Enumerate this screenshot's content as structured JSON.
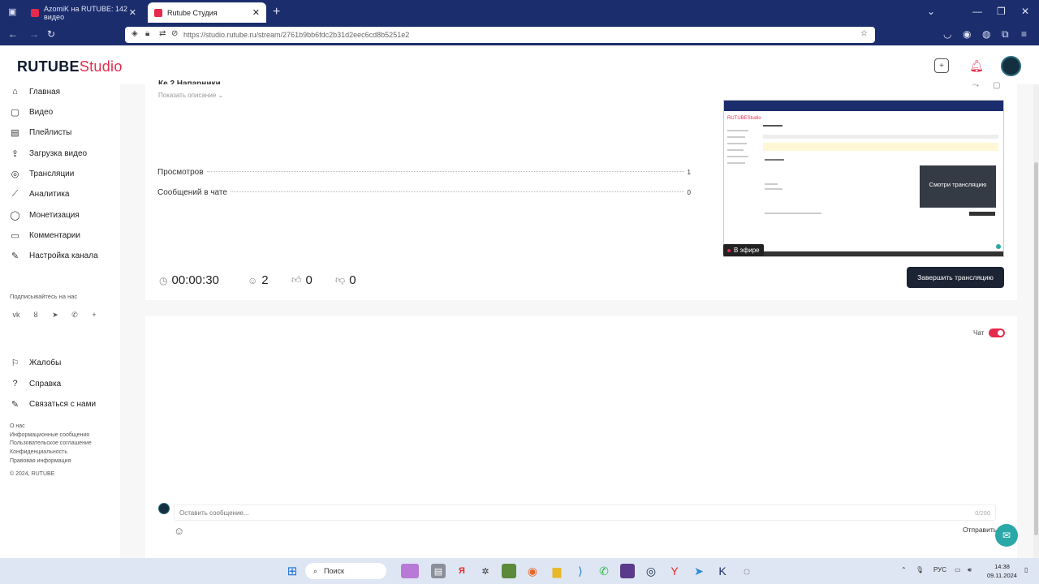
{
  "browser": {
    "tabs": [
      {
        "label": "AzomiK на RUTUBE: 142 видео"
      },
      {
        "label": "Rutube Студия"
      }
    ],
    "url": "https://studio.rutube.ru/stream/2761b9bb6fdc2b31d2eec6cd8b5251e2"
  },
  "app": {
    "logo_main": "RUTUBE",
    "logo_studio": "Studio"
  },
  "sidebar": {
    "items": [
      {
        "label": "Главная",
        "icon": "home-icon"
      },
      {
        "label": "Видео",
        "icon": "video-icon"
      },
      {
        "label": "Плейлисты",
        "icon": "playlist-icon"
      },
      {
        "label": "Загрузка видео",
        "icon": "upload-icon"
      },
      {
        "label": "Трансляции",
        "icon": "broadcast-icon"
      },
      {
        "label": "Аналитика",
        "icon": "analytics-icon"
      },
      {
        "label": "Монетизация",
        "icon": "monetization-icon"
      },
      {
        "label": "Комментарии",
        "icon": "comments-icon"
      },
      {
        "label": "Настройка канала",
        "icon": "settings-icon"
      }
    ],
    "subscribe_label": "Подписывайтесь на нас",
    "social": [
      "vk-icon",
      "ok-icon",
      "telegram-icon",
      "viber-icon",
      "plus-icon"
    ],
    "support_items": [
      {
        "label": "Жалобы",
        "icon": "complaint-icon"
      },
      {
        "label": "Справка",
        "icon": "help-icon"
      },
      {
        "label": "Связаться с нами",
        "icon": "contact-icon"
      }
    ],
    "footer": [
      "О нас",
      "Информационные сообщения",
      "Пользовательское соглашение",
      "Конфиденциальность",
      "Правовая информация",
      "© 2024, RUTUBE"
    ]
  },
  "stream": {
    "title_partial": "Ке 2 Напарники",
    "show_description": "Показать описание",
    "stats": [
      {
        "label": "Просмотров",
        "value": "1"
      },
      {
        "label": "Сообщений в чате",
        "value": "0"
      }
    ],
    "duration": "00:00:30",
    "viewers": "2",
    "likes": "0",
    "dislikes": "0",
    "end_button": "Завершить трансляцию",
    "on_air": "В эфире",
    "preview_overlay": "Смотри трансляцию",
    "preview_logo": "RUTUBE",
    "preview_logo_studio": "Studio"
  },
  "chat": {
    "label": "Чат",
    "enabled": true,
    "placeholder": "Оставить сообщение...",
    "counter": "0/200",
    "send_label": "Отправить"
  },
  "taskbar": {
    "search_label": "Поиск",
    "lang": "РУС",
    "time": "14:38",
    "date": "09.11.2024"
  },
  "colors": {
    "brand_red": "#e52a4c",
    "browser_bar": "#1c2d6d",
    "end_button_bg": "#1c2333",
    "support_teal": "#2aa8a8"
  }
}
